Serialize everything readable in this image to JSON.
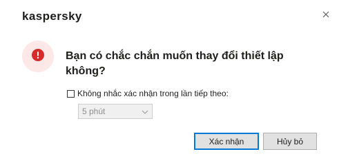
{
  "app": {
    "logo_text": "kaspersky"
  },
  "dialog": {
    "message": "Bạn có chắc chắn muốn thay đổi thiết lập không?",
    "checkbox_label": "Không nhắc xác nhận trong lần tiếp theo:",
    "checkbox_checked": false,
    "select_value": "5 phút",
    "select_disabled": true,
    "confirm_label": "Xác nhận",
    "cancel_label": "Hủy bỏ"
  },
  "icons": {
    "close": "close-icon",
    "alert": "exclamation-circle-icon",
    "dropdown": "chevron-down-icon"
  },
  "colors": {
    "alert_red": "#d52b2b",
    "alert_bg": "#fde8e8",
    "focus_border": "#0078d7"
  }
}
